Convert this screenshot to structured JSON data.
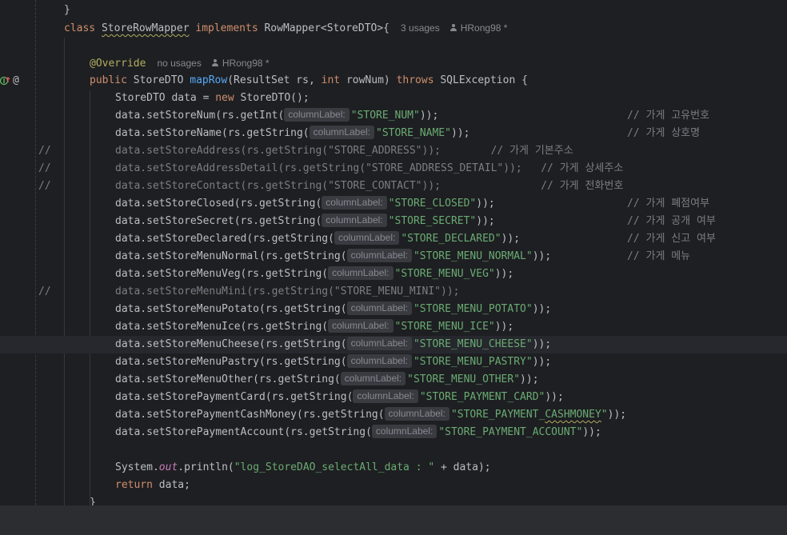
{
  "editor": {
    "lines": [
      {
        "code": [
          [
            "plain",
            "}"
          ]
        ]
      },
      {
        "code": [
          [
            "kw",
            "class "
          ],
          [
            "ul",
            "StoreRowMapper"
          ],
          [
            "kw",
            " implements "
          ],
          [
            "plain",
            "RowMapper<StoreDTO>{"
          ]
        ],
        "meta": {
          "usages": "3 usages",
          "author": "HRong98 *"
        }
      },
      {
        "code": []
      },
      {
        "code": [
          [
            "ann",
            "@Override"
          ]
        ],
        "meta": {
          "usages": "no usages",
          "author": "HRong98 *"
        }
      },
      {
        "code": [
          [
            "kw",
            "public "
          ],
          [
            "plain",
            "StoreDTO "
          ],
          [
            "fn",
            "mapRow"
          ],
          [
            "plain",
            "(ResultSet rs, "
          ],
          [
            "kw",
            "int "
          ],
          [
            "plain",
            "rowNum) "
          ],
          [
            "kw",
            "throws "
          ],
          [
            "plain",
            "SQLException {"
          ]
        ]
      },
      {
        "code": [
          [
            "plain",
            "StoreDTO data = "
          ],
          [
            "kw",
            "new "
          ],
          [
            "plain",
            "StoreDTO();"
          ]
        ]
      },
      {
        "code": [
          [
            "plain",
            "data.setStoreNum(rs.getInt("
          ],
          [
            "hint",
            "columnLabel:"
          ],
          [
            "str",
            "\"STORE_NUM\""
          ],
          [
            "plain",
            "));"
          ]
        ],
        "comment": "// 가게 고유번호"
      },
      {
        "code": [
          [
            "plain",
            "data.setStoreName(rs.getString("
          ],
          [
            "hint",
            "columnLabel:"
          ],
          [
            "str",
            "\"STORE_NAME\""
          ],
          [
            "plain",
            "));"
          ]
        ],
        "comment": "// 가게 상호명"
      },
      {
        "gutter": "//",
        "code": [
          [
            "cmt",
            "data.setStoreAddress(rs.getString(\"STORE_ADDRESS\"));        // 가게 기본주소"
          ]
        ]
      },
      {
        "gutter": "//",
        "code": [
          [
            "cmt",
            "data.setStoreAddressDetail(rs.getString(\"STORE_ADDRESS_DETAIL\"));   // 가게 상세주소"
          ]
        ]
      },
      {
        "gutter": "//",
        "code": [
          [
            "cmt",
            "data.setStoreContact(rs.getString(\"STORE_CONTACT\"));                // 가게 전화번호"
          ]
        ]
      },
      {
        "code": [
          [
            "plain",
            "data.setStoreClosed(rs.getString("
          ],
          [
            "hint",
            "columnLabel:"
          ],
          [
            "str",
            "\"STORE_CLOSED\""
          ],
          [
            "plain",
            "));"
          ]
        ],
        "comment": "// 가게 폐점여부"
      },
      {
        "code": [
          [
            "plain",
            "data.setStoreSecret(rs.getString("
          ],
          [
            "hint",
            "columnLabel:"
          ],
          [
            "str",
            "\"STORE_SECRET\""
          ],
          [
            "plain",
            "));"
          ]
        ],
        "comment": "// 가게 공개 여부"
      },
      {
        "code": [
          [
            "plain",
            "data.setStoreDeclared(rs.getString("
          ],
          [
            "hint",
            "columnLabel:"
          ],
          [
            "str",
            "\"STORE_DECLARED\""
          ],
          [
            "plain",
            "));"
          ]
        ],
        "comment": "// 가게 신고 여부"
      },
      {
        "code": [
          [
            "plain",
            "data.setStoreMenuNormal(rs.getString("
          ],
          [
            "hint",
            "columnLabel:"
          ],
          [
            "str",
            "\"STORE_MENU_NORMAL\""
          ],
          [
            "plain",
            "));"
          ]
        ],
        "comment": "// 가게 메뉴"
      },
      {
        "code": [
          [
            "plain",
            "data.setStoreMenuVeg(rs.getString("
          ],
          [
            "hint",
            "columnLabel:"
          ],
          [
            "str",
            "\"STORE_MENU_VEG\""
          ],
          [
            "plain",
            "));"
          ]
        ]
      },
      {
        "gutter": "//",
        "code": [
          [
            "cmt",
            "data.setStoreMenuMini(rs.getString(\"STORE_MENU_MINI\"));"
          ]
        ]
      },
      {
        "code": [
          [
            "plain",
            "data.setStoreMenuPotato(rs.getString("
          ],
          [
            "hint",
            "columnLabel:"
          ],
          [
            "str",
            "\"STORE_MENU_POTATO\""
          ],
          [
            "plain",
            "));"
          ]
        ]
      },
      {
        "code": [
          [
            "plain",
            "data.setStoreMenuIce(rs.getString("
          ],
          [
            "hint",
            "columnLabel:"
          ],
          [
            "str",
            "\"STORE_MENU_ICE\""
          ],
          [
            "plain",
            "));"
          ]
        ]
      },
      {
        "current": true,
        "code": [
          [
            "plain",
            "data.setStoreMenuCheese(rs.getString("
          ],
          [
            "hint",
            "columnLabel:"
          ],
          [
            "str",
            "\"STORE_MENU_CHEESE\""
          ],
          [
            "plain",
            "));"
          ]
        ]
      },
      {
        "code": [
          [
            "plain",
            "data.setStoreMenuPastry(rs.getString("
          ],
          [
            "hint",
            "columnLabel:"
          ],
          [
            "str",
            "\"STORE_MENU_PASTRY\""
          ],
          [
            "plain",
            "));"
          ]
        ]
      },
      {
        "code": [
          [
            "plain",
            "data.setStoreMenuOther(rs.getString("
          ],
          [
            "hint",
            "columnLabel:"
          ],
          [
            "str",
            "\"STORE_MENU_OTHER\""
          ],
          [
            "plain",
            "));"
          ]
        ]
      },
      {
        "code": [
          [
            "plain",
            "data.setStorePaymentCard(rs.getString("
          ],
          [
            "hint",
            "columnLabel:"
          ],
          [
            "str",
            "\"STORE_PAYMENT_CARD\""
          ],
          [
            "plain",
            "));"
          ]
        ]
      },
      {
        "code": [
          [
            "plain",
            "data.setStorePaymentCashMoney(rs.getString("
          ],
          [
            "hint",
            "columnLabel:"
          ],
          [
            "str",
            "\"STORE_PAYMENT_"
          ],
          [
            "strul",
            "CASHMONEY"
          ],
          [
            "str",
            "\""
          ],
          [
            "plain",
            "));"
          ]
        ]
      },
      {
        "code": [
          [
            "plain",
            "data.setStorePaymentAccount(rs.getString("
          ],
          [
            "hint",
            "columnLabel:"
          ],
          [
            "str",
            "\"STORE_PAYMENT_ACCOUNT\""
          ],
          [
            "plain",
            "));"
          ]
        ]
      },
      {
        "code": []
      },
      {
        "code": [
          [
            "plain",
            "System."
          ],
          [
            "fld",
            "out"
          ],
          [
            "plain",
            ".println("
          ],
          [
            "str",
            "\"log_StoreDAO_selectAll_data : \""
          ],
          [
            "plain",
            " + data);"
          ]
        ]
      },
      {
        "code": [
          [
            "kw",
            "return "
          ],
          [
            "plain",
            "data;"
          ]
        ]
      },
      {
        "code": [
          [
            "plain",
            "}"
          ]
        ]
      }
    ]
  },
  "gutter_icons": {
    "implements_icon": "implements-method-icon",
    "annotation_icon": "@"
  },
  "colors": {
    "background": "#1e1f22",
    "keyword": "#cf8e6d",
    "function": "#56a8f5",
    "string": "#6aab73",
    "annotation": "#b3ae60",
    "comment": "#7a7e85"
  }
}
